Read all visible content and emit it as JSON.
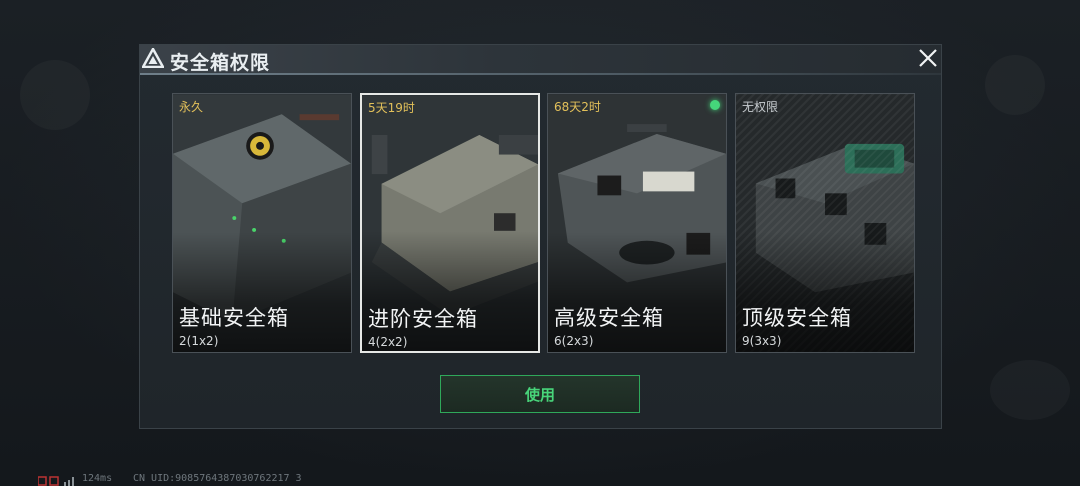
{
  "dialog": {
    "title": "安全箱权限",
    "use_label": "使用"
  },
  "cards": [
    {
      "time": "永久",
      "name": "基础安全箱",
      "size": "2(1x2)",
      "selected": false,
      "active": false
    },
    {
      "time": "5天19时",
      "name": "进阶安全箱",
      "size": "4(2x2)",
      "selected": true,
      "active": false
    },
    {
      "time": "68天2时",
      "name": "高级安全箱",
      "size": "6(2x3)",
      "selected": false,
      "active": true
    },
    {
      "time": "无权限",
      "name": "顶级安全箱",
      "size": "9(3x3)",
      "selected": false,
      "active": false
    }
  ],
  "footer": {
    "ping": "124ms",
    "uid": "CN UID:9085764387030762217 3"
  },
  "colors": {
    "accent_green": "#48d47a",
    "time_gold": "#e2c05a"
  }
}
